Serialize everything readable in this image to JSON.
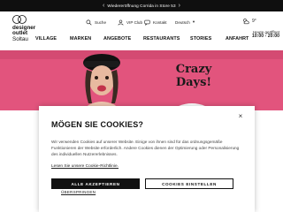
{
  "announcement": {
    "text": "Wiedereröffnung Corrida in Store 53"
  },
  "logo": {
    "line1": "designer",
    "line2": "outlet",
    "line3": "Soltau"
  },
  "utility": {
    "search": "Suche",
    "vip": "VIP Club",
    "contact": "Kontakt",
    "language": "Deutsch"
  },
  "weather": {
    "temp": "9°"
  },
  "hours": {
    "label": "Heute geöffnet",
    "time": "10:00 - 20:00"
  },
  "nav": {
    "village": "VILLAGE",
    "brands": "MARKEN",
    "offers": "ANGEBOTE",
    "restaurants": "RESTAURANTS",
    "stories": "STORIES",
    "directions": "ANFAHRT"
  },
  "hero": {
    "badge_line1": "Crazy",
    "badge_line2": "Days!"
  },
  "cookie": {
    "title": "MÖGEN SIE COOKIES?",
    "body": "Wir verwenden Cookies auf unserer Website. Einige von ihnen sind für das ordnungsgemäße Funktionieren der Website erforderlich. Andere Cookies dienen der Optimierung oder Personalisierung des individuellen Nutzererlebnisses.",
    "link": "Lesen Sie unsere Cookie-Richtlinie.",
    "accept": "ALLE AKZEPTIEREN",
    "settings": "COOKIES EINSTELLEN",
    "skip": "ÜBERSPRINGEN"
  },
  "colors": {
    "hero_pink": "#e2547d",
    "dark": "#111111"
  }
}
